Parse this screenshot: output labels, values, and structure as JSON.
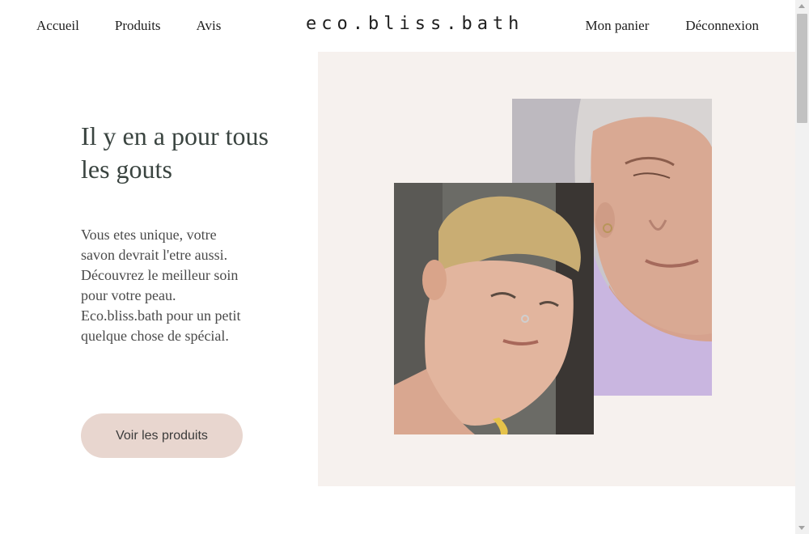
{
  "header": {
    "nav_left": [
      "Accueil",
      "Produits",
      "Avis"
    ],
    "brand": "eco.bliss.bath",
    "nav_right": [
      "Mon panier",
      "Déconnexion"
    ]
  },
  "hero": {
    "title": "Il y en a pour tous les gouts",
    "text": "Vous etes unique, votre savon devrait l'etre aussi. Découvrez le meilleur soin pour votre peau. Eco.bliss.bath pour un petit quelque chose de spécial.",
    "cta_label": "Voir les produits"
  },
  "colors": {
    "panel_background": "#f6f1ee",
    "button_background": "#e8d6cf",
    "heading_color": "#3a4440"
  }
}
